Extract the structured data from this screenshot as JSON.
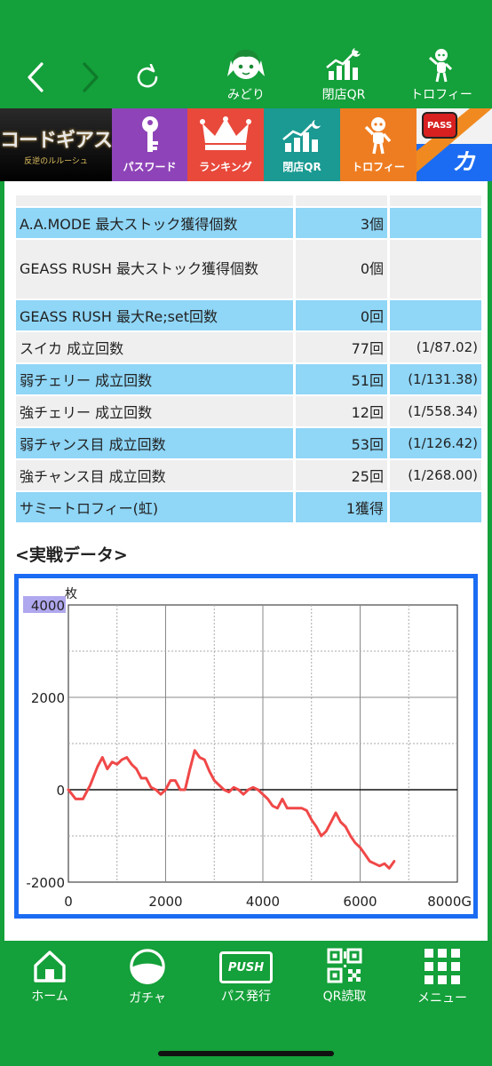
{
  "topnav": {
    "items": [
      {
        "label": "みどり",
        "icon": "character-face-icon"
      },
      {
        "label": "閉店QR",
        "icon": "chart-moon-icon"
      },
      {
        "label": "トロフィー",
        "icon": "trophy-figure-icon"
      }
    ]
  },
  "banner": {
    "logo_title": "コードギアス",
    "logo_sub": "反逆のルルーシュ",
    "password": "パスワード",
    "ranking": "ランキング",
    "closeqr": "閉店QR",
    "trophy": "トロフィー",
    "pass_badge": "PASS",
    "katsu": "カチ"
  },
  "stats": {
    "rows": [
      {
        "name": "A.A.MODE 最大ストック獲得個数",
        "count": "3個",
        "rate": ""
      },
      {
        "name": "GEASS RUSH 最大ストック獲得個数",
        "count": "0個",
        "rate": ""
      },
      {
        "name": "GEASS RUSH 最大Re;set回数",
        "count": "0回",
        "rate": ""
      },
      {
        "name": "スイカ 成立回数",
        "count": "77回",
        "rate": "(1/87.02)"
      },
      {
        "name": "弱チェリー 成立回数",
        "count": "51回",
        "rate": "(1/131.38)"
      },
      {
        "name": "強チェリー 成立回数",
        "count": "12回",
        "rate": "(1/558.34)"
      },
      {
        "name": "弱チャンス目 成立回数",
        "count": "53回",
        "rate": "(1/126.42)"
      },
      {
        "name": "強チャンス目 成立回数",
        "count": "25回",
        "rate": "(1/268.00)"
      },
      {
        "name": "サミートロフィー(虹)",
        "count": "1獲得",
        "rate": ""
      }
    ]
  },
  "section_title": "<実戦データ>",
  "chart_data": {
    "type": "line",
    "yunit": "枚",
    "xunit": "G",
    "xlim": [
      0,
      8000
    ],
    "ylim": [
      -2000,
      4000
    ],
    "xticks": [
      "0",
      "2000",
      "4000",
      "6000",
      "8000G"
    ],
    "yticks": [
      "4000",
      "2000",
      "0",
      "-2000"
    ],
    "grid": true,
    "line_color": "#f04848",
    "series": [
      {
        "x": [
          0,
          150,
          300,
          450,
          600,
          700,
          800,
          900,
          1000,
          1100,
          1200,
          1300,
          1400,
          1500,
          1600,
          1700,
          1800,
          1900,
          2000,
          2100,
          2200,
          2300,
          2400,
          2500,
          2600,
          2700,
          2800,
          2900,
          3000,
          3100,
          3200,
          3300,
          3400,
          3500,
          3600,
          3700,
          3800,
          3900,
          4000,
          4100,
          4200,
          4300,
          4400,
          4500,
          4600,
          4700,
          4800,
          4900,
          5000,
          5100,
          5200,
          5300,
          5400,
          5500,
          5600,
          5700,
          5800,
          5900,
          6000,
          6100,
          6200,
          6300,
          6400,
          6500,
          6600,
          6700
        ],
        "y": [
          0,
          -200,
          -200,
          100,
          500,
          700,
          450,
          600,
          550,
          650,
          700,
          550,
          450,
          250,
          250,
          50,
          0,
          -100,
          0,
          200,
          200,
          0,
          0,
          450,
          850,
          700,
          650,
          400,
          200,
          100,
          0,
          -50,
          50,
          0,
          -100,
          0,
          50,
          0,
          -100,
          -200,
          -350,
          -400,
          -200,
          -400,
          -400,
          -400,
          -400,
          -450,
          -650,
          -800,
          -1000,
          -900,
          -700,
          -500,
          -700,
          -800,
          -1000,
          -1150,
          -1250,
          -1400,
          -1550,
          -1600,
          -1650,
          -1600,
          -1700,
          -1550
        ]
      }
    ]
  },
  "bottomnav": {
    "home": "ホーム",
    "gacha": "ガチャ",
    "pass": "パス発行",
    "push_badge": "PUSH",
    "qr": "QR読取",
    "menu": "メニュー"
  }
}
